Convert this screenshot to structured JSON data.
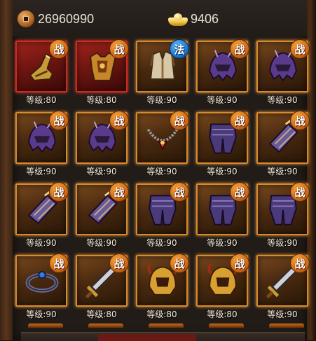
{
  "currency": {
    "copper": "26960990",
    "gold": "9406"
  },
  "slots": [
    {
      "level": "等级:80",
      "badge": "战",
      "cls": "warrior",
      "frame": "red",
      "item": "boots-icon"
    },
    {
      "level": "等级:80",
      "badge": "战",
      "cls": "warrior",
      "frame": "red",
      "item": "armor-icon"
    },
    {
      "level": "等级:90",
      "badge": "法",
      "cls": "mage",
      "frame": "gold",
      "item": "robe-icon"
    },
    {
      "level": "等级:90",
      "badge": "战",
      "cls": "warrior",
      "frame": "gold",
      "item": "helmet-icon"
    },
    {
      "level": "等级:90",
      "badge": "战",
      "cls": "warrior",
      "frame": "gold",
      "item": "helmet-icon"
    },
    {
      "level": "等级:90",
      "badge": "战",
      "cls": "warrior",
      "frame": "gold",
      "item": "helmet-icon"
    },
    {
      "level": "等级:90",
      "badge": "战",
      "cls": "warrior",
      "frame": "gold",
      "item": "helmet-icon"
    },
    {
      "level": "等级:90",
      "badge": "战",
      "cls": "warrior",
      "frame": "gold",
      "item": "necklace-icon"
    },
    {
      "level": "等级:90",
      "badge": "战",
      "cls": "warrior",
      "frame": "gold",
      "item": "leggings-icon"
    },
    {
      "level": "等级:90",
      "badge": "战",
      "cls": "warrior",
      "frame": "gold",
      "item": "bracer-icon"
    },
    {
      "level": "等级:90",
      "badge": "战",
      "cls": "warrior",
      "frame": "gold",
      "item": "bracer-icon"
    },
    {
      "level": "等级:90",
      "badge": "战",
      "cls": "warrior",
      "frame": "gold",
      "item": "bracer-icon"
    },
    {
      "level": "等级:90",
      "badge": "战",
      "cls": "warrior",
      "frame": "gold",
      "item": "leggings-icon"
    },
    {
      "level": "等级:90",
      "badge": "战",
      "cls": "warrior",
      "frame": "gold",
      "item": "leggings-icon"
    },
    {
      "level": "等级:90",
      "badge": "战",
      "cls": "warrior",
      "frame": "gold",
      "item": "leggings-icon"
    },
    {
      "level": "等级:90",
      "badge": "战",
      "cls": "warrior",
      "frame": "gold",
      "item": "ring-icon"
    },
    {
      "level": "等级:80",
      "badge": "战",
      "cls": "warrior",
      "frame": "gold",
      "item": "sword-icon"
    },
    {
      "level": "等级:80",
      "badge": "战",
      "cls": "warrior",
      "frame": "gold",
      "item": "gold-helmet-icon"
    },
    {
      "level": "等级:80",
      "badge": "战",
      "cls": "warrior",
      "frame": "gold",
      "item": "gold-helmet-icon"
    },
    {
      "level": "等级:90",
      "badge": "战",
      "cls": "warrior",
      "frame": "gold",
      "item": "sword-icon"
    }
  ]
}
